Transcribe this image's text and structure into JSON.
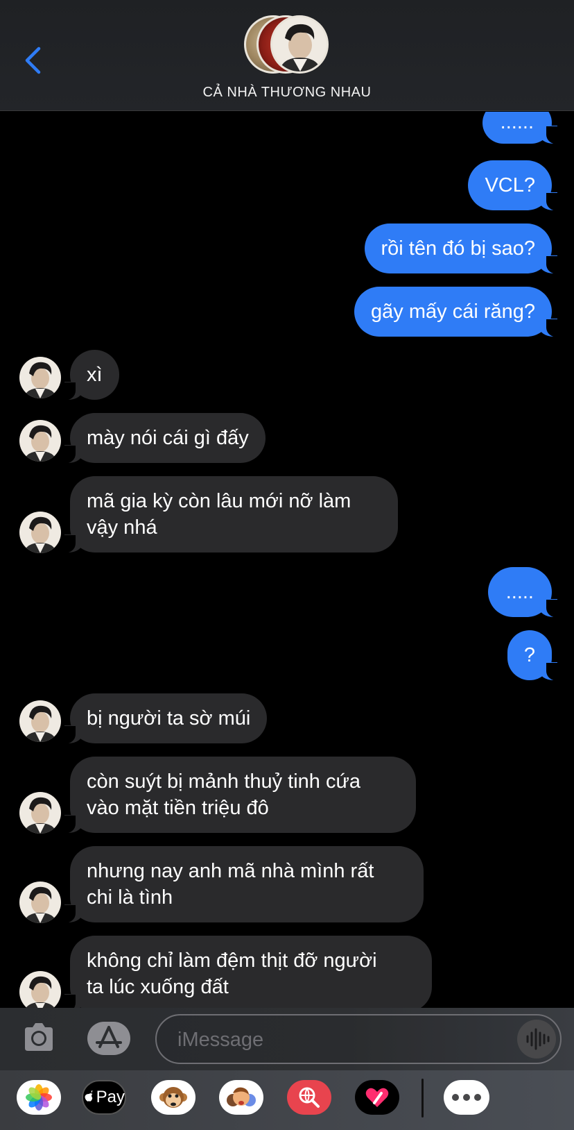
{
  "header": {
    "title": "CẢ NHÀ THƯƠNG NHAU"
  },
  "messages": [
    {
      "dir": "out",
      "text": "......"
    },
    {
      "dir": "out",
      "text": "VCL?"
    },
    {
      "dir": "out",
      "text": "rồi tên đó bị sao?"
    },
    {
      "dir": "out",
      "text": "gãy mấy cái răng?"
    },
    {
      "dir": "in",
      "text": "xì"
    },
    {
      "dir": "in",
      "text": "mày nói cái gì đấy"
    },
    {
      "dir": "in",
      "line1": "mã gia kỳ còn lâu mới nỡ làm",
      "line2": "vậy nhá"
    },
    {
      "dir": "out",
      "text": "....."
    },
    {
      "dir": "out",
      "text": "?"
    },
    {
      "dir": "in",
      "text": "bị người ta sờ múi"
    },
    {
      "dir": "in",
      "line1": "còn suýt bị mảnh thuỷ tinh cứa",
      "line2": "vào mặt tiền triệu đô"
    },
    {
      "dir": "in",
      "line1": "nhưng nay anh mã nhà mình rất",
      "line2": "chi là tình"
    },
    {
      "dir": "in",
      "line1": "không chỉ làm đệm thịt đỡ người",
      "line2": "ta lúc xuống đất"
    }
  ],
  "input": {
    "placeholder": "iMessage"
  },
  "apps": [
    {
      "name": "photos-app-icon"
    },
    {
      "name": "apple-pay-app-icon",
      "label": "Pay"
    },
    {
      "name": "animoji-app-icon"
    },
    {
      "name": "memoji-app-icon"
    },
    {
      "name": "image-search-app-icon"
    },
    {
      "name": "digital-touch-app-icon"
    },
    {
      "name": "more-apps-icon"
    }
  ],
  "colors": {
    "outgoing_bubble": "#2f7cf6",
    "incoming_bubble": "#2a2a2c",
    "back_chevron": "#2f7cf6"
  }
}
